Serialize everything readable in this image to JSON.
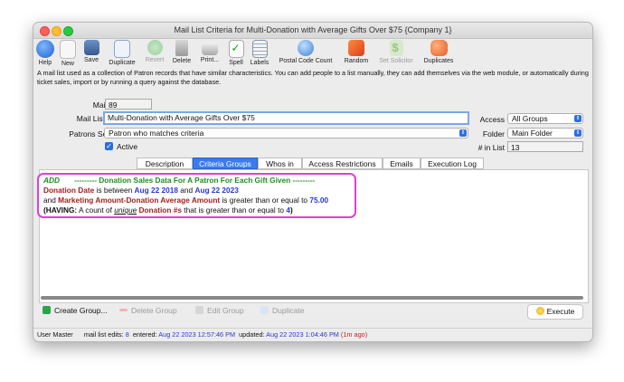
{
  "window": {
    "title": "Mail List Criteria for Multi-Donation with Average Gifts Over $75 {Company 1}"
  },
  "toolbar": [
    {
      "label": "Help",
      "icon": "help-icon",
      "enabled": true
    },
    {
      "label": "New",
      "icon": "new-icon",
      "enabled": true
    },
    {
      "label": "Save",
      "icon": "save-icon",
      "enabled": true
    },
    {
      "label": "Duplicate",
      "icon": "duplicate-icon",
      "enabled": true
    },
    {
      "label": "Revert",
      "icon": "revert-icon",
      "enabled": false
    },
    {
      "label": "Delete",
      "icon": "trash-icon",
      "enabled": true
    },
    {
      "label": "Print...",
      "icon": "print-icon",
      "enabled": true
    },
    {
      "label": "Spell",
      "icon": "spell-check-icon",
      "enabled": true
    },
    {
      "label": "Labels",
      "icon": "labels-icon",
      "enabled": true
    },
    {
      "label": "Postal Code Count",
      "icon": "globe-icon",
      "enabled": true
    },
    {
      "label": "Random",
      "icon": "dice-icon",
      "enabled": true
    },
    {
      "label": "Set Solicitor",
      "icon": "dollar-icon",
      "enabled": false
    },
    {
      "label": "Duplicates",
      "icon": "duplicates-icon",
      "enabled": true
    }
  ],
  "description": "A mail list used as a collection of Patron records that have similar characteristics.  You can add people to a list manually, they can add themselves via the web module, or automatically during ticket sales, import or by running a query against the database.",
  "form": {
    "mail_list_num_label": "Mail List #",
    "mail_list_num": "89",
    "mail_list_name_label": "Mail List Name",
    "mail_list_name": "Multi-Donation with Average Gifts Over $75",
    "patrons_selected_label": "Patrons Selected",
    "patrons_selected": "Patron who matches criteria",
    "active_label": "Active",
    "active": true,
    "access_label": "Access",
    "access": "All Groups",
    "folder_label": "Folder",
    "folder": "Main Folder",
    "in_list_label": "# in List",
    "in_list": "13"
  },
  "tabs": [
    "Description",
    "Criteria Groups",
    "Whos in",
    "Access Restrictions",
    "Emails",
    "Execution Log"
  ],
  "active_tab": "Criteria Groups",
  "criteria": {
    "add": "ADD",
    "header": "--------- Donation Sales Data For A Patron For Each Gift Given ---------",
    "line1": {
      "field": "Donation Date",
      "op": "is between",
      "v1": "Aug 22 2018",
      "and": "and",
      "v2": "Aug 22 2023"
    },
    "line2": {
      "and": "and",
      "field": "Marketing Amount-Donation Average Amount",
      "op": "is greater than or equal to",
      "value": "75.00"
    },
    "line3": {
      "open": "(HAVING:",
      "text1": "A count of",
      "unique": "unique",
      "field": "Donation #s",
      "text2": "that is greater than or equal to",
      "value": "4",
      "close": ")"
    }
  },
  "buttons": {
    "create_group": "Create Group...",
    "delete_group": "Delete Group",
    "edit_group": "Edit Group",
    "duplicate": "Duplicate",
    "execute": "Execute"
  },
  "status": {
    "user": "User Master",
    "edits_label": "mail list edits:",
    "edits": "8",
    "entered_label": "entered:",
    "entered": "Aug 22 2023 12:57:46 PM",
    "updated_label": "updated:",
    "updated": "Aug 22 2023 1:04:46 PM",
    "ago": "(1m ago)"
  }
}
